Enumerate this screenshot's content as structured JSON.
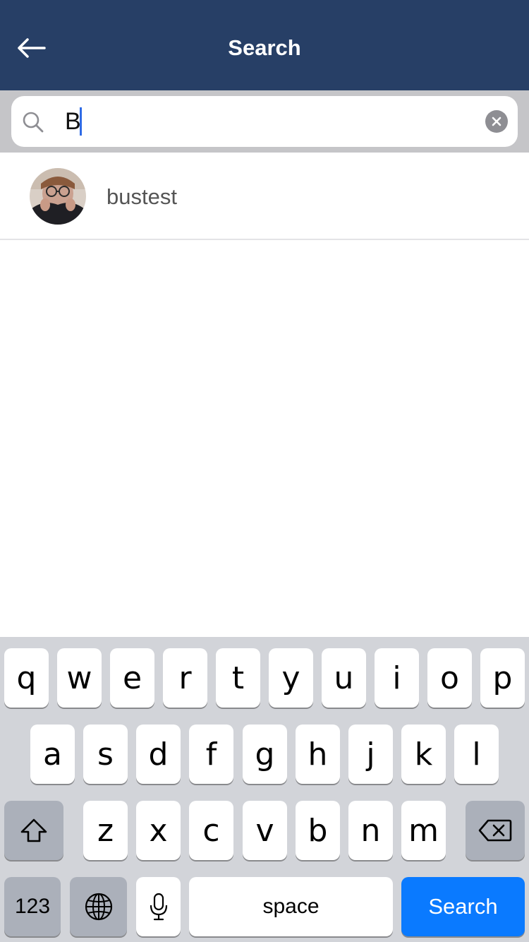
{
  "header": {
    "title": "Search",
    "back_icon": "arrow-left-icon"
  },
  "search": {
    "value": "B",
    "icon": "search-icon",
    "clear_icon": "clear-icon"
  },
  "results": [
    {
      "name": "bustest",
      "avatar": "avatar"
    }
  ],
  "keyboard": {
    "row1": [
      "q",
      "w",
      "e",
      "r",
      "t",
      "y",
      "u",
      "i",
      "o",
      "p"
    ],
    "row2": [
      "a",
      "s",
      "d",
      "f",
      "g",
      "h",
      "j",
      "k",
      "l"
    ],
    "row3": [
      "z",
      "x",
      "c",
      "v",
      "b",
      "n",
      "m"
    ],
    "numbers_label": "123",
    "space_label": "space",
    "search_label": "Search",
    "shift_icon": "shift-icon",
    "backspace_icon": "backspace-icon",
    "globe_icon": "globe-icon",
    "mic_icon": "microphone-icon"
  },
  "colors": {
    "header_bg": "#273f66",
    "accent": "#0a7aff",
    "caret": "#2f6be6"
  }
}
